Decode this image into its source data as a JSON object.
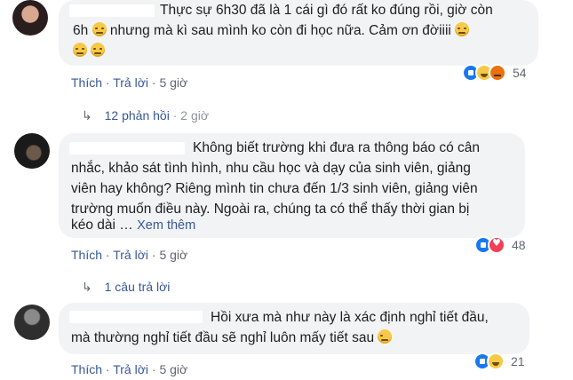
{
  "comments": [
    {
      "text_lines": [
        "Thực sự 6h30 đã là 1 cái gì đó rất ko đúng rồi, giờ còn",
        "6h",
        "nhưng mà kì sau mình ko còn đi học nữa. Cảm ơn đờiiii"
      ],
      "reply_label": "Thích",
      "answer_label": "Trả lời",
      "time": "5 giờ",
      "reaction_icons": [
        "like",
        "haha",
        "angry"
      ],
      "reaction_count": "54"
    },
    {
      "text_lines": [
        "Không biết trường khi đưa ra thông báo có cân",
        "nhắc, khảo sát tình hình, nhu cầu học và dạy của sinh viên, giảng",
        "viên hay không? Riêng mình tin chưa đến 1/3 sinh viên, giảng viên",
        "trường muốn điều này. Ngoài ra, chúng ta có thể thấy thời gian bị",
        "kéo dài …"
      ],
      "see_more": "Xem thêm",
      "reply_label": "Thích",
      "answer_label": "Trả lời",
      "time": "5 giờ",
      "reaction_icons": [
        "like",
        "love"
      ],
      "reaction_count": "48"
    },
    {
      "text_lines": [
        "Hồi xưa mà như này là xác định nghỉ tiết đầu,",
        "mà thường nghỉ tiết đầu sẽ nghỉ luôn mấy tiết sau"
      ],
      "reply_label": "Thích",
      "answer_label": "Trả lời",
      "time": "5 giờ",
      "reaction_icons": [
        "like",
        "haha"
      ],
      "reaction_count": "21"
    }
  ],
  "reply_threads": [
    {
      "label": "12 phản hồi",
      "time": "2 giờ"
    },
    {
      "label": "1 câu trả lời"
    }
  ],
  "separator": "·",
  "arrow": "↳"
}
